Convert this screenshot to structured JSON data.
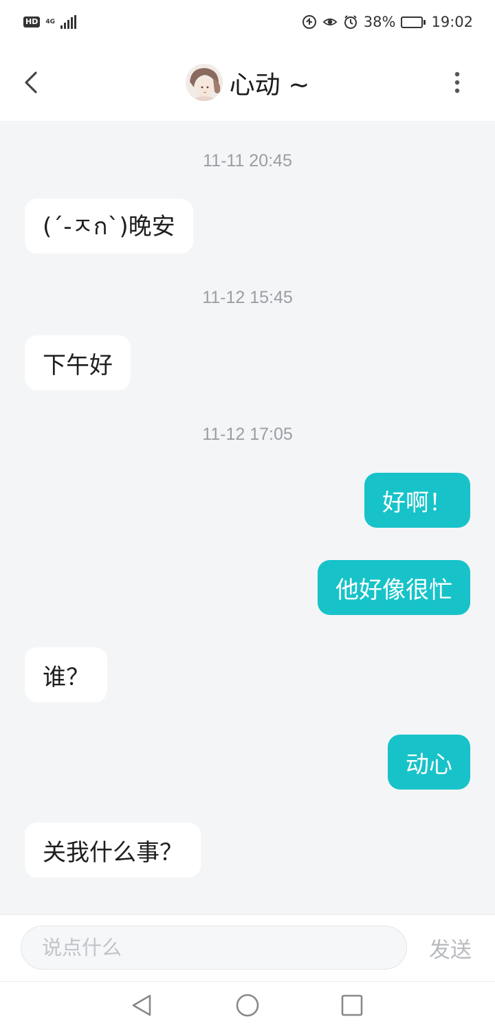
{
  "status_bar": {
    "hd": "HD",
    "network": "4G",
    "battery": "38%",
    "battery_level": 0.38,
    "time": "19:02"
  },
  "header": {
    "title": "心动 ~",
    "back_icon": "chevron-left-icon",
    "more_icon": "more-vertical-icon"
  },
  "messages": [
    {
      "type": "time",
      "text": "11-11 20:45"
    },
    {
      "type": "in",
      "text": "(´-ㅈก`)晚安"
    },
    {
      "type": "time",
      "text": "11-12 15:45"
    },
    {
      "type": "in",
      "text": "下午好"
    },
    {
      "type": "time",
      "text": "11-12 17:05"
    },
    {
      "type": "out",
      "text": "好啊！"
    },
    {
      "type": "out",
      "text": "他好像很忙"
    },
    {
      "type": "in",
      "text": "谁？"
    },
    {
      "type": "out",
      "text": "动心"
    },
    {
      "type": "in",
      "text": "关我什么事？"
    }
  ],
  "input": {
    "placeholder": "说点什么",
    "value": "",
    "send_label": "发送"
  },
  "colors": {
    "accent": "#17c3c9",
    "background": "#f4f5f7",
    "timestamp": "#9a9da3"
  }
}
